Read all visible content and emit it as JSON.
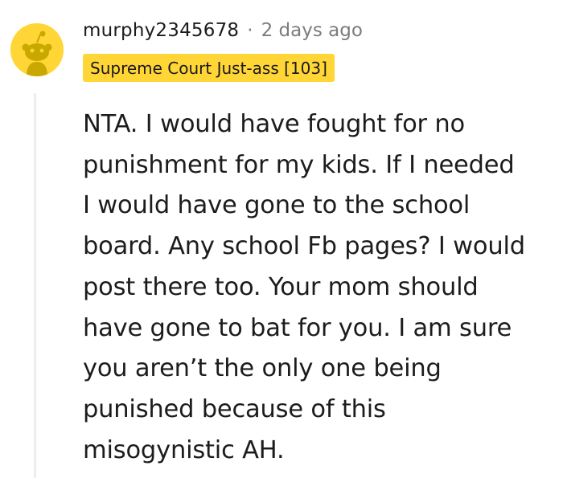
{
  "comment": {
    "username": "murphy2345678",
    "separator": "·",
    "timestamp": "2 days ago",
    "flair": "Supreme Court Just-ass [103]",
    "body_lines": [
      "NTA. I would have fought for no",
      "punishment for my kids. If I needed",
      "I would have gone to the school",
      "board. Any school Fb pages? I would",
      "post there too. Your mom should",
      "have gone to bat for you. I am sure",
      "you aren’t the only one being",
      "punished because of this",
      "misogynistic AH."
    ],
    "avatar_icon": "snoo-avatar-icon",
    "colors": {
      "avatar_bg": "#FFD635",
      "flair_bg": "#FFD635",
      "username": "#1c1c1c",
      "meta": "#7c7c7c",
      "thread_line": "#ededed"
    }
  }
}
